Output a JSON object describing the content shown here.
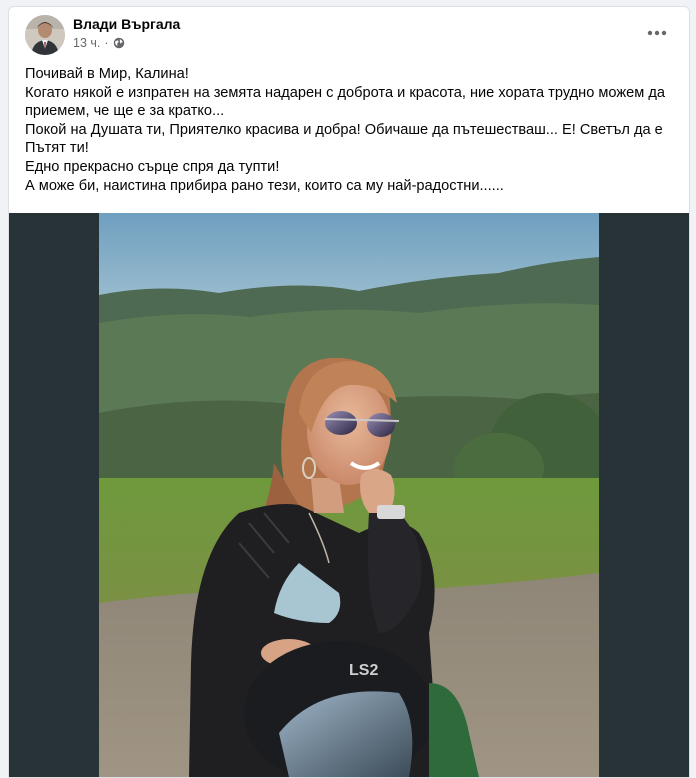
{
  "post": {
    "author": "Влади Въргала",
    "time": "13 ч.",
    "privacy_icon": "globe-icon",
    "more_icon": "more-options-icon",
    "lines": [
      "Почивай в Мир, Калина!",
      "Когато някой е изпратен на земята надарен с доброта и красота, ние хората трудно можем да приемем, че ще е за кратко...",
      "Покой на Душата ти, Приятелко красива и добра! Обичаше да пътешестваш... Е! Светъл да е Пътят ти!",
      "Едно прекрасно сърце спря да тупти!",
      "А може би, наистина прибира рано тези, които са му най-радостни......"
    ]
  },
  "photo": {
    "helmet_text": "LS2"
  },
  "colors": {
    "page_bg": "#f0f2f5",
    "card_bg": "#ffffff",
    "media_bg": "#283338",
    "text": "#050505",
    "meta": "#65676b"
  }
}
